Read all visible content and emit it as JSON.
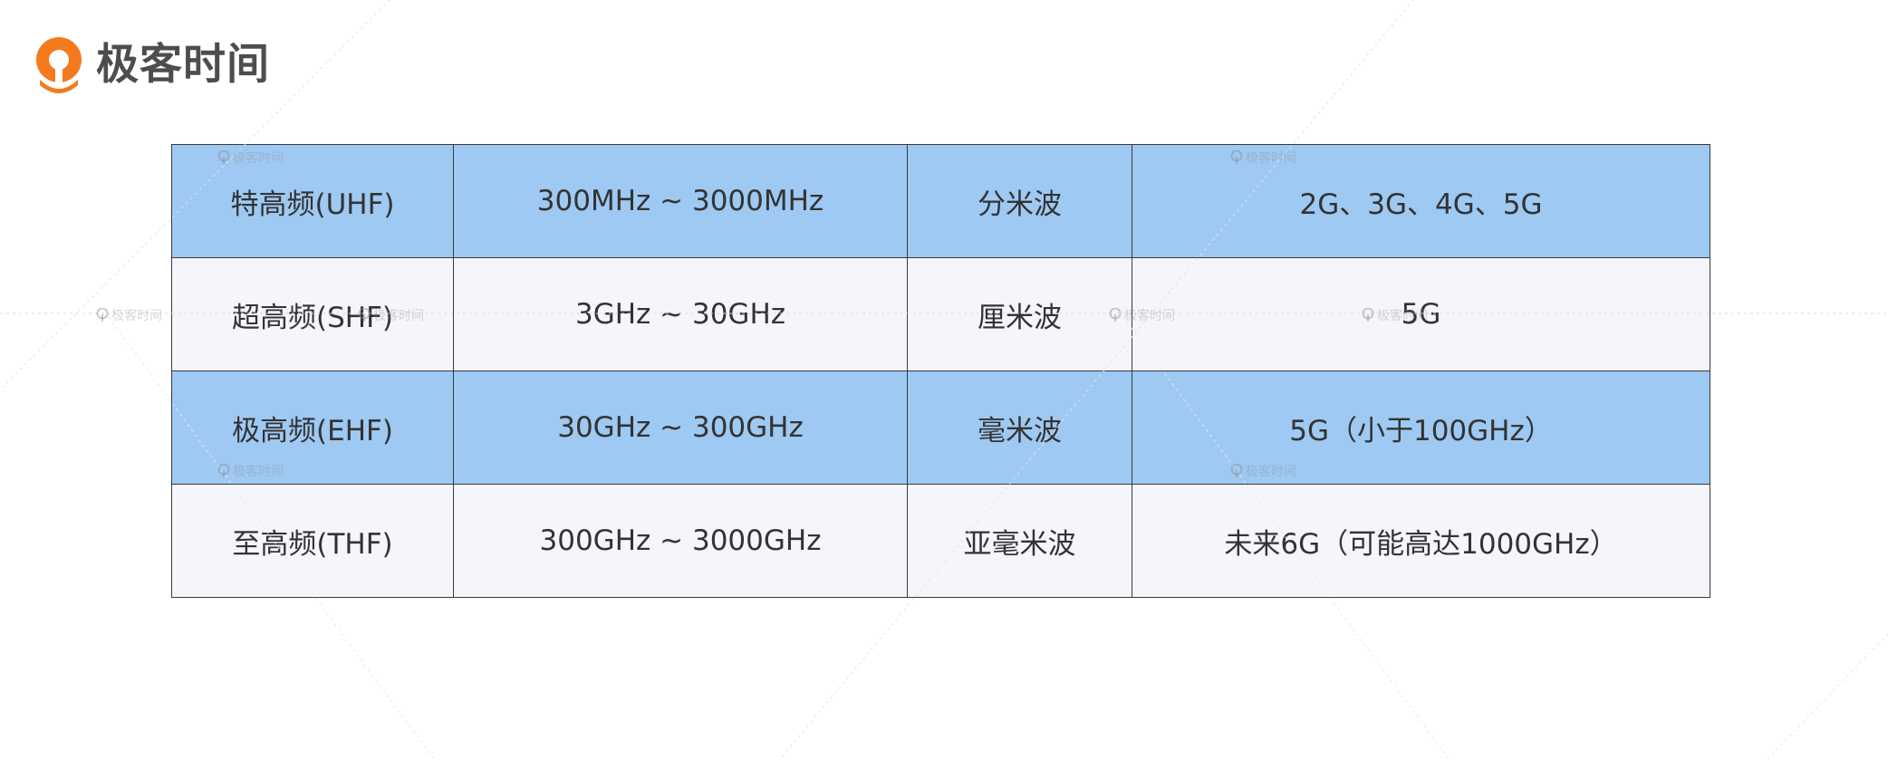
{
  "brand": {
    "name": "极客时间",
    "logo_icon": "geektime-logo-icon",
    "colors": {
      "logo_orange": "#f37b1d",
      "row_blue": "#9ec9f2",
      "row_light": "#f5f6fc"
    }
  },
  "table": {
    "rows": [
      {
        "band": "特高频(UHF)",
        "range": "300MHz ~ 3000MHz",
        "wave": "分米波",
        "usage": "2G、3G、4G、5G"
      },
      {
        "band": "超高频(SHF)",
        "range": "3GHz ~ 30GHz",
        "wave": "厘米波",
        "usage": "5G"
      },
      {
        "band": "极高频(EHF)",
        "range": "30GHz ~ 300GHz",
        "wave": "毫米波",
        "usage": "5G（小于100GHz）"
      },
      {
        "band": "至高频(THF)",
        "range": "300GHz ~ 3000GHz",
        "wave": "亚毫米波",
        "usage": "未来6G（可能高达1000GHz）"
      }
    ]
  }
}
